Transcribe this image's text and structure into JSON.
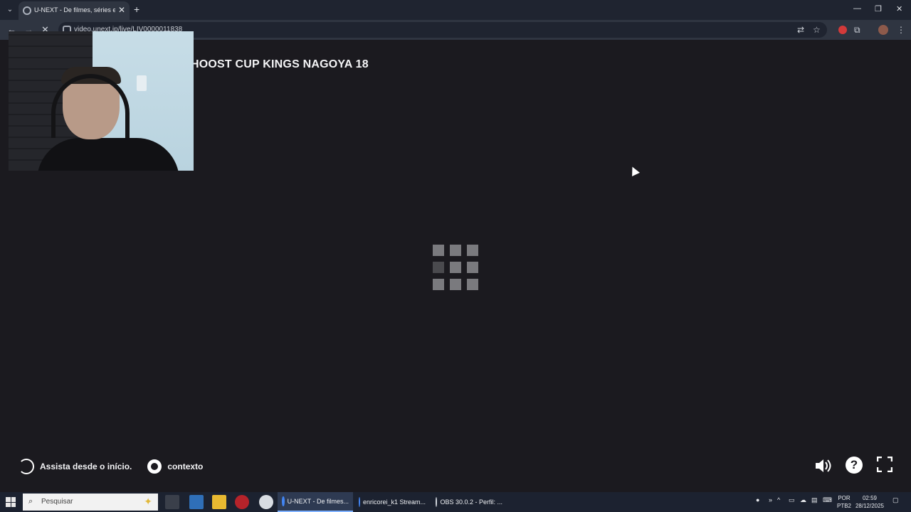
{
  "browser": {
    "tab_title": "U-NEXT - De filmes, séries e an",
    "url": "video.unext.jp/live/LIV0000011838",
    "new_tab_symbol": "+",
    "close_symbol": "✕"
  },
  "page": {
    "video_title": "HOOST CUP KINGS NAGOYA 18",
    "controls": {
      "replay_label": "Assista desde o início.",
      "settings_label": "contexto",
      "help_symbol": "?"
    }
  },
  "taskbar": {
    "search_placeholder": "Pesquisar",
    "tasks": [
      {
        "label": "U-NEXT - De filmes...",
        "color": "#4285f4",
        "active": true
      },
      {
        "label": "enricorei_k1 Stream...",
        "color": "#4285f4",
        "active": false
      },
      {
        "label": "OBS 30.0.2 - Perfil: ...",
        "color": "#cfd3da",
        "active": false
      }
    ],
    "lang_top": "POR",
    "lang_bottom": "PTB2",
    "time": "02:59",
    "date": "28/12/2025"
  },
  "icons": {
    "back": "back-arrow-icon",
    "forward": "forward-arrow-icon",
    "stop": "stop-loading-icon",
    "translate": "translate-icon",
    "bookmark": "star-icon",
    "extensions": "puzzle-icon",
    "spinner": "loading-grid-icon",
    "replay": "replay-icon",
    "settings": "gear-icon",
    "volume": "volume-icon",
    "help": "help-icon",
    "fullscreen": "fullscreen-icon"
  }
}
